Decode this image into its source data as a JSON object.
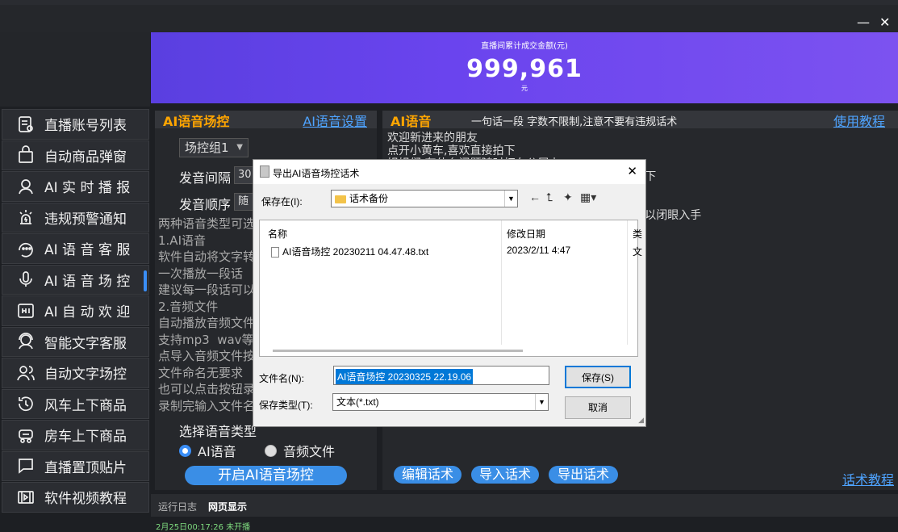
{
  "window": {
    "close_label": "✕",
    "min_label": "—"
  },
  "banner": {
    "label": "直播间累计成交金额(元)",
    "amount": "999,961",
    "unit": "元"
  },
  "sidebar": {
    "items": [
      {
        "label": "直播账号列表",
        "icon": "account-list-icon"
      },
      {
        "label": "自动商品弹窗",
        "icon": "shopping-bag-icon"
      },
      {
        "label": "AI 实 时 播 报",
        "icon": "broadcaster-icon"
      },
      {
        "label": "违规预警通知",
        "icon": "alert-icon"
      },
      {
        "label": "AI 语 音 客 服",
        "icon": "voice-service-icon"
      },
      {
        "label": "AI 语 音 场 控",
        "icon": "microphone-icon"
      },
      {
        "label": "AI 自 动 欢 迎",
        "icon": "hi-icon"
      },
      {
        "label": "智能文字客服",
        "icon": "headset-icon"
      },
      {
        "label": "自动文字场控",
        "icon": "users-icon"
      },
      {
        "label": "风车上下商品",
        "icon": "refresh-clock-icon"
      },
      {
        "label": "房车上下商品",
        "icon": "car-icon"
      },
      {
        "label": "直播置顶贴片",
        "icon": "chat-bubble-icon"
      },
      {
        "label": "软件视频教程",
        "icon": "video-icon"
      }
    ]
  },
  "left_panel": {
    "title": "AI语音场控",
    "settings_link": "AI语音设置",
    "group_select": "场控组1",
    "interval_label": "发音间隔",
    "interval_value": "30",
    "order_label": "发音顺序",
    "order_value": "随",
    "description": "两种语音类型可选\n1.AI语音\n软件自动将文字转\n一次播放一段话\n建议每一段话可以\n2.音频文件\n自动播放音频文件\n支持mp3  wav等\n点导入音频文件按\n文件命名无要求\n也可以点击按钮录\n录制完输入文件名",
    "voice_type_label": "选择语音类型",
    "radio_ai": "AI语音",
    "radio_audio": "音频文件",
    "start_button": "开启AI语音场控"
  },
  "right_panel": {
    "title": "AI语音",
    "subtitle": "一句话一段 字数不限制,注意不要有违规话术",
    "tutorial_link": "使用教程",
    "script_text": "欢迎新进来的朋友\n点开小黄车,喜欢直接拍下\n姐姐们 有什么问题随时打在公屏上\n                                                        喜欢直接拍下\n\n                                                        款式\n                                                        是青仓，可以闭眼入手",
    "edit_button": "编辑话术",
    "import_button": "导入话术",
    "export_button": "导出话术",
    "script_link": "话术教程"
  },
  "log": {
    "tab_log": "运行日志",
    "tab_web": "网页显示",
    "line": "2月25日00:17:26 未开播"
  },
  "dialog": {
    "title": "导出AI语音场控话术",
    "save_in_label": "保存在(I):",
    "folder": "话术备份",
    "col_name": "名称",
    "col_date": "修改日期",
    "col_type": "类",
    "file_name": "AI语音场控 20230211 04.47.48.txt",
    "file_date": "2023/2/11 4:47",
    "file_type": "文",
    "filename_label": "文件名(N):",
    "filename_value": "AI语音场控 20230325 22.19.06",
    "filetype_label": "保存类型(T):",
    "filetype_value": "文本(*.txt)",
    "save_button": "保存(S)",
    "cancel_button": "取消"
  }
}
